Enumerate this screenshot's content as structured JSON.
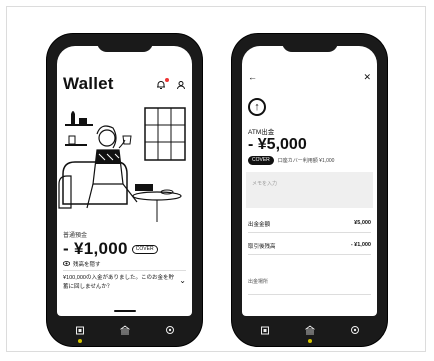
{
  "left_phone": {
    "title": "Wallet",
    "account_label": "普通預金",
    "balance": "- ¥1,000",
    "cover_badge": "COVER",
    "hide_balance": "残高を隠す",
    "notice": "¥100,000の入金がありました。このお金を貯蓄に回しませんか？",
    "icons": [
      "bell-icon",
      "user-icon",
      "chevron-down-icon"
    ]
  },
  "right_phone": {
    "title": "ATM出金",
    "amount": "- ¥5,000",
    "cover_badge": "COVER",
    "cover_note": "口座カバー利用額 ¥1,000",
    "memo_placeholder": "メモを入力",
    "rows": [
      {
        "label": "出金金額",
        "value": "¥5,000"
      },
      {
        "label": "取引後残高",
        "value": "- ¥1,000"
      }
    ],
    "location_label": "出金場所",
    "icons": [
      "back-arrow-icon",
      "close-icon",
      "arrow-up-circle-icon"
    ]
  },
  "nav": {
    "left_active": 0,
    "right_active": 1,
    "icons": [
      "wallet-icon",
      "bank-icon",
      "settings-icon"
    ]
  },
  "colors": {
    "accent_dot": "#d4c400",
    "notify_dot": "#e33333",
    "phone_body": "#1a1a1a"
  }
}
